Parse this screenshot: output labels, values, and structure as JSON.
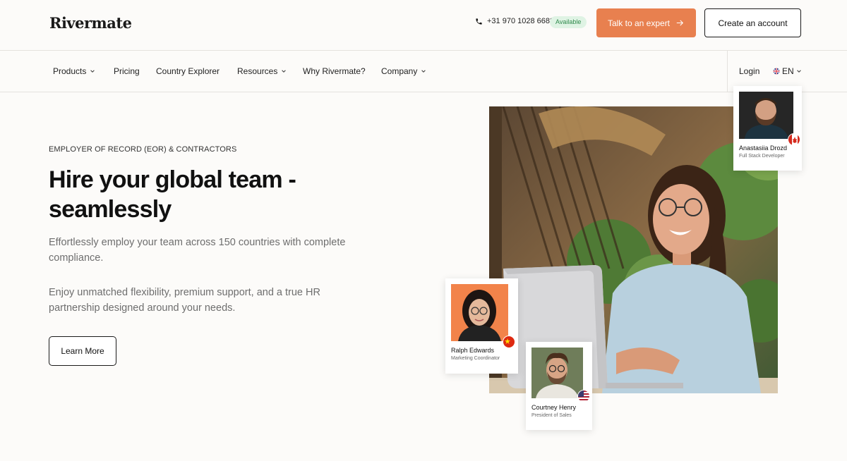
{
  "brand": {
    "logo": "Rivermate",
    "accent": "#e8804f"
  },
  "header": {
    "phone": "+31 970 1028 6682",
    "availability": "Available",
    "talk_button": "Talk to an expert",
    "create_button": "Create an account"
  },
  "nav": {
    "items": [
      {
        "label": "Products",
        "dropdown": true
      },
      {
        "label": "Pricing",
        "dropdown": false
      },
      {
        "label": "Country Explorer",
        "dropdown": false
      },
      {
        "label": "Resources",
        "dropdown": true
      },
      {
        "label": "Why Rivermate?",
        "dropdown": false
      },
      {
        "label": "Company",
        "dropdown": true
      }
    ],
    "login": "Login",
    "language": "EN"
  },
  "hero": {
    "eyebrow": "EMPLOYER OF RECORD (EOR) & CONTRACTORS",
    "headline_line1": "Hire your global team -",
    "headline_line2": "seamlessly",
    "para1": "Effortlessly employ your team across 150 countries with complete compliance.",
    "para2": "Enjoy unmatched flexibility, premium support, and a true HR partnership designed around your needs.",
    "cta": "Learn More"
  },
  "profiles": [
    {
      "name": "Anastasiia Drozd",
      "role": "Full Stack Developer",
      "flag": "canada-flag-icon"
    },
    {
      "name": "Ralph Edwards",
      "role": "Marketing Coordinator",
      "flag": "china-flag-icon"
    },
    {
      "name": "Courtney Henry",
      "role": "President of Sales",
      "flag": "usa-flag-icon"
    }
  ]
}
